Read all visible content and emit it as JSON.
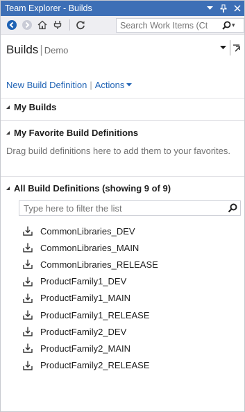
{
  "window": {
    "title": "Team Explorer - Builds",
    "controls": {
      "dropdown": "▾",
      "pin": "ᵖ",
      "close": "✕"
    }
  },
  "toolbar": {
    "search_placeholder": "Search Work Items (Ct",
    "icons": [
      "back-icon",
      "forward-icon",
      "home-icon",
      "connect-icon",
      "refresh-icon"
    ]
  },
  "header": {
    "title": "Builds",
    "separator": "|",
    "subtitle": "Demo"
  },
  "links": {
    "new_definition": "New Build Definition",
    "separator": "|",
    "actions": "Actions"
  },
  "sections": {
    "my_builds": "My Builds",
    "favorites": "My Favorite Build Definitions",
    "favorites_hint": "Drag build definitions here to add them to your favorites.",
    "all_definitions": "All Build Definitions (showing 9 of 9)"
  },
  "filter": {
    "placeholder": "Type here to filter the list"
  },
  "definitions": [
    "CommonLibraries_DEV",
    "CommonLibraries_MAIN",
    "CommonLibraries_RELEASE",
    "ProductFamily1_DEV",
    "ProductFamily1_MAIN",
    "ProductFamily1_RELEASE",
    "ProductFamily2_DEV",
    "ProductFamily2_MAIN",
    "ProductFamily2_RELEASE"
  ],
  "colors": {
    "titlebar": "#3d6fb6",
    "link": "#1e62b4",
    "toolbar": "#eeeef2"
  }
}
